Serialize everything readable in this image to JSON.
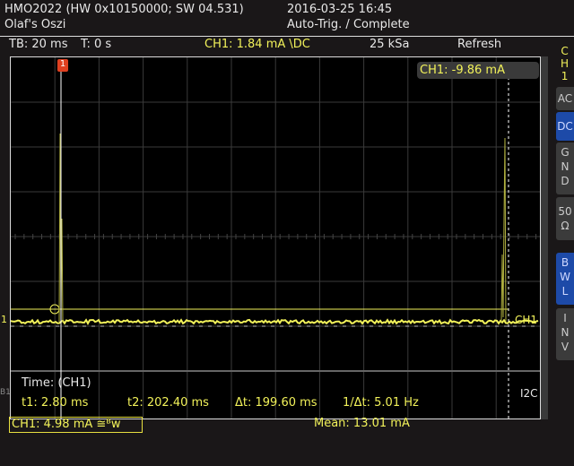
{
  "header": {
    "device": "HMO2022 (HW 0x10150000; SW 04.531)",
    "name": "Olaf's Oszi",
    "datetime": "2016-03-25 16:45",
    "status": "Auto-Trig. / Complete"
  },
  "toolbar": {
    "timebase": "TB: 20 ms",
    "trigger_time": "T: 0 s",
    "channel": "CH1: 1.84 mA \\DC",
    "sample_rate": "25 kSa",
    "mode": "Refresh"
  },
  "cursor_readout": "CH1: -9.86 mA",
  "channel_label": "CH1",
  "trigger_marker": "1",
  "ground_marker": "1",
  "side_panel": {
    "channel": [
      "C",
      "H",
      "1"
    ],
    "buttons": [
      {
        "label": "AC",
        "active": false
      },
      {
        "label": "DC",
        "active": true
      },
      {
        "label": "G N D",
        "active": false
      },
      {
        "label": "50 Ω",
        "active": false
      },
      {
        "label": "B W L",
        "active": true
      },
      {
        "label": "I N V",
        "active": false
      }
    ]
  },
  "measurements": {
    "title": "Time: (CH1)",
    "t1": "t1: 2.80 ms",
    "t2": "t2: 202.40 ms",
    "dt": "Δt: 199.60 ms",
    "inv_dt": "1/Δt: 5.01 Hz",
    "side_label": "I2C",
    "left_label": "B1"
  },
  "footer": {
    "ch1": "CH1: 4.98 mA ≅ᴮᴡ",
    "mean": "Mean: 13.01 mA"
  },
  "colors": {
    "trace": "#f2f25a",
    "trigger": "#e04020",
    "active_button": "#1d4aa8"
  }
}
